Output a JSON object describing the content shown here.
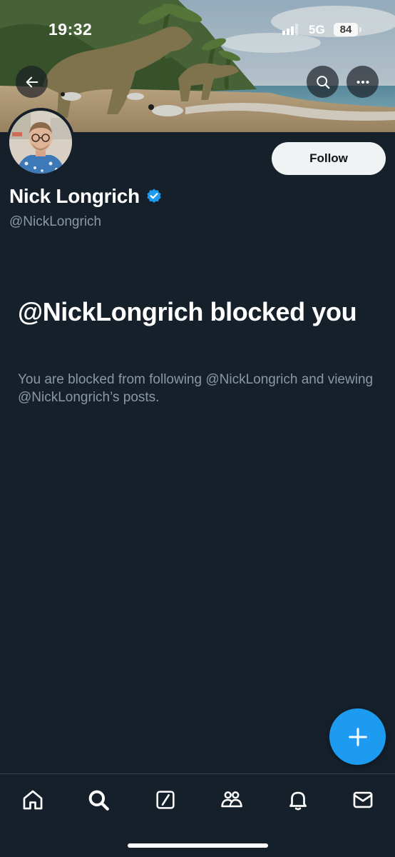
{
  "status_bar": {
    "time": "19:32",
    "network": "5G",
    "battery": "84",
    "icons": [
      "signal-bars-icon",
      "battery-icon"
    ]
  },
  "header": {
    "banner_description": "banner-illustration",
    "icons": [
      "back-arrow-icon",
      "search-icon",
      "more-options-icon"
    ]
  },
  "profile": {
    "display_name": "Nick Longrich",
    "handle": "@NickLongrich",
    "verified": true,
    "follow_label": "Follow"
  },
  "blocked_notice": {
    "title": "@NickLongrich blocked you",
    "description": "You are blocked from following @NickLongrich and viewing @NickLongrich’s posts."
  },
  "fab": {
    "icon": "plus-icon"
  },
  "bottom_nav": {
    "items": [
      {
        "icon": "home-icon"
      },
      {
        "icon": "search-icon"
      },
      {
        "icon": "grok-icon"
      },
      {
        "icon": "communities-icon"
      },
      {
        "icon": "notifications-bell-icon"
      },
      {
        "icon": "messages-envelope-icon"
      }
    ]
  },
  "colors": {
    "background": "#15202b",
    "accent": "#1d9bf0",
    "secondary_text": "#8b98a5",
    "divider": "#38444d",
    "follow_button_bg": "#eff3f4"
  }
}
